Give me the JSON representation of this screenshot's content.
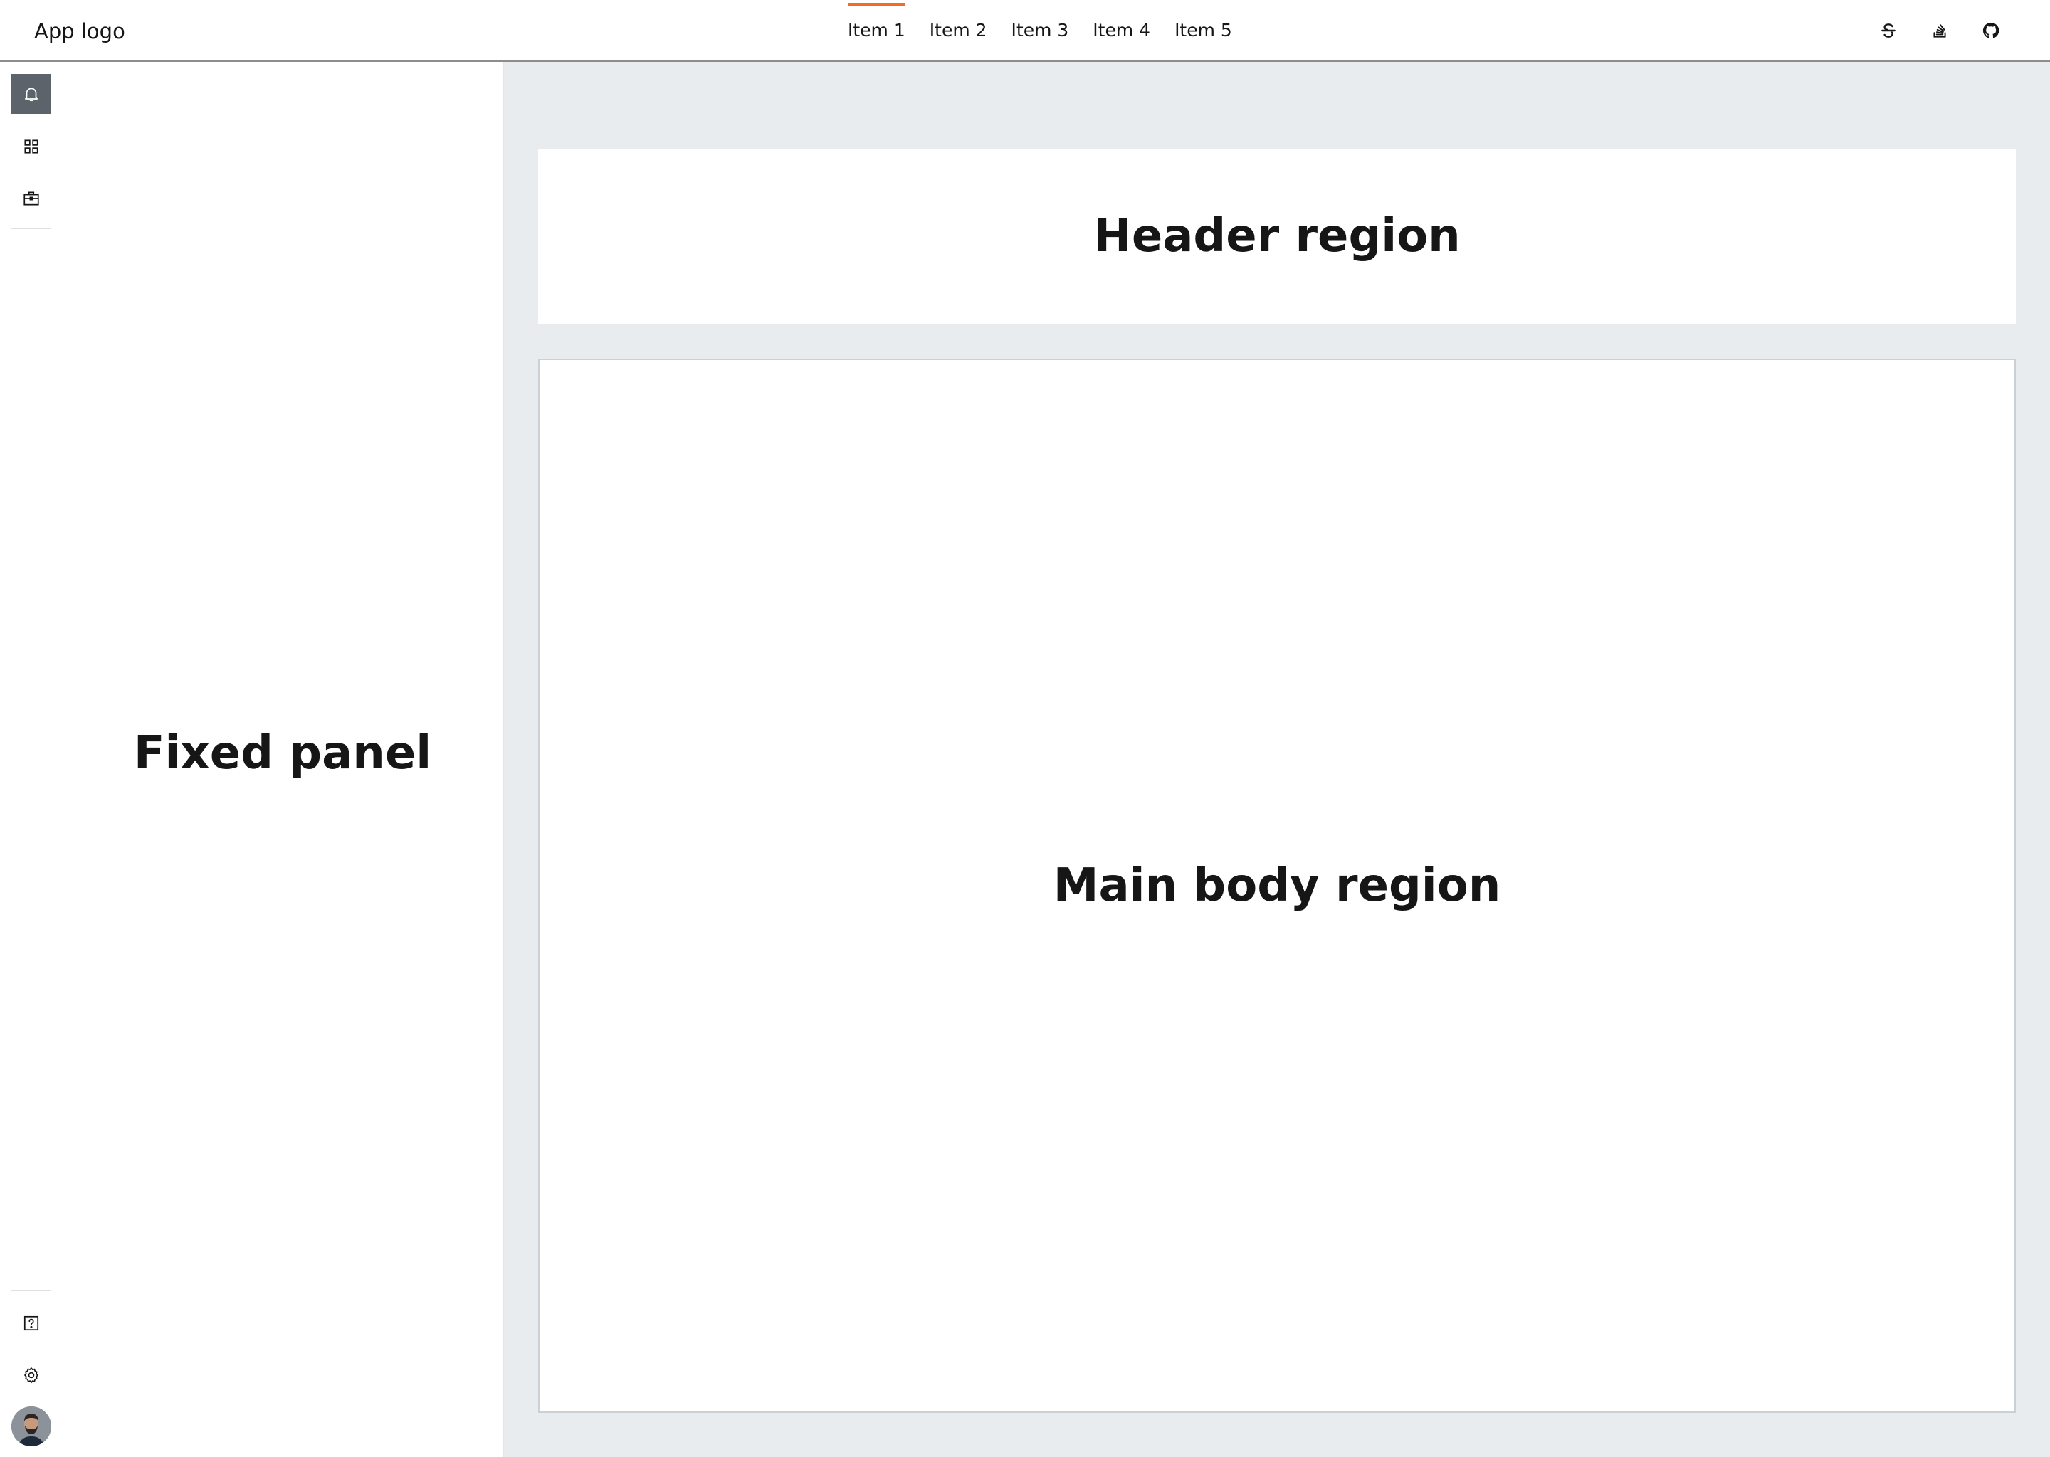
{
  "app": {
    "logo_text": "App logo"
  },
  "nav": {
    "items": [
      {
        "label": "Item 1",
        "active": true
      },
      {
        "label": "Item 2",
        "active": false
      },
      {
        "label": "Item 3",
        "active": false
      },
      {
        "label": "Item 4",
        "active": false
      },
      {
        "label": "Item 5",
        "active": false
      }
    ],
    "active_color": "#f36a23"
  },
  "top_actions": [
    {
      "icon": "strikethrough-s-icon"
    },
    {
      "icon": "stack-overflow-icon"
    },
    {
      "icon": "github-icon"
    }
  ],
  "rail": {
    "top_items": [
      {
        "icon": "notification-bell-icon",
        "active": true
      },
      {
        "icon": "grid-apps-icon",
        "active": false
      },
      {
        "icon": "briefcase-icon",
        "active": false
      }
    ],
    "bottom_items": [
      {
        "icon": "help-icon"
      },
      {
        "icon": "settings-gear-icon"
      },
      {
        "icon": "user-avatar"
      }
    ]
  },
  "fixed_panel": {
    "label": "Fixed panel"
  },
  "content": {
    "header_label": "Header region",
    "main_label": "Main body region"
  },
  "colors": {
    "content_background": "#e8ecef",
    "rail_active": "#5d636b",
    "accent": "#f36a23"
  }
}
